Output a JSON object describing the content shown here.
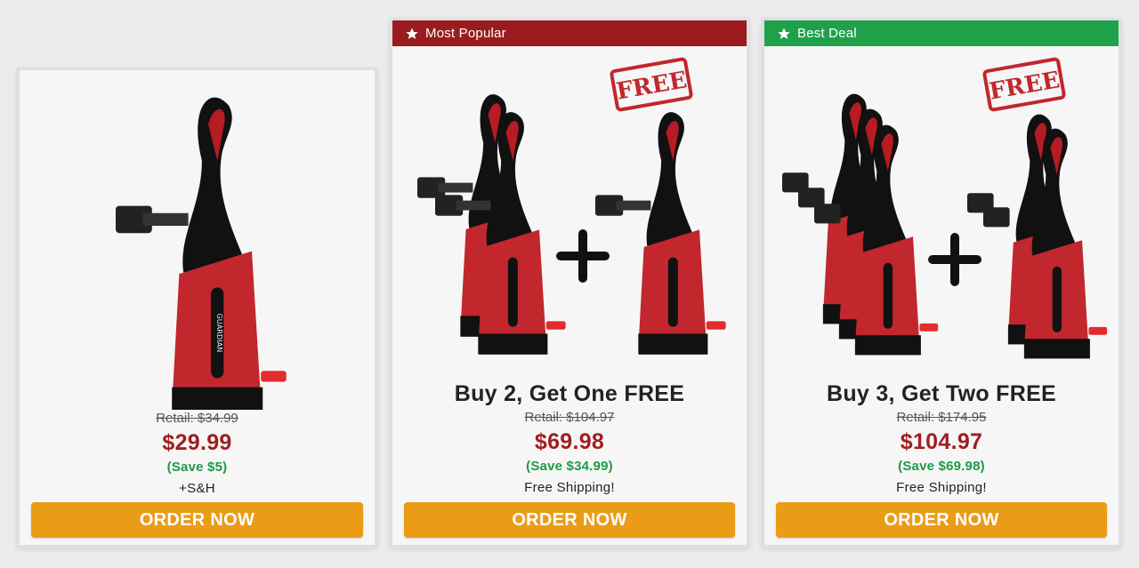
{
  "colors": {
    "price_red": "#a01e22",
    "save_green": "#1e9a48",
    "ribbon_red": "#9a1c1f",
    "ribbon_green": "#1fa14a",
    "button_orange": "#eb9c16",
    "free_stamp_red": "#c1272d"
  },
  "offers": [
    {
      "retail": "Retail: $34.99",
      "price": "$29.99",
      "save": "(Save $5)",
      "shipping": "+S&H",
      "button": "ORDER NOW",
      "product_count": 1
    },
    {
      "badge": "Most Popular",
      "badge_icon": "star-icon",
      "title": "Buy 2, Get One FREE",
      "retail": "Retail: $104.97",
      "price": "$69.98",
      "save": "(Save $34.99)",
      "shipping": "Free Shipping!",
      "button": "ORDER NOW",
      "stamp": "FREE",
      "product_count": 2,
      "free_count": 1
    },
    {
      "badge": "Best Deal",
      "badge_icon": "star-icon",
      "title": "Buy 3, Get Two FREE",
      "retail": "Retail: $174.95",
      "price": "$104.97",
      "save": "(Save $69.98)",
      "shipping": "Free Shipping!",
      "button": "ORDER NOW",
      "stamp": "FREE",
      "product_count": 3,
      "free_count": 2
    }
  ],
  "product_brand": "GUARDIAN"
}
